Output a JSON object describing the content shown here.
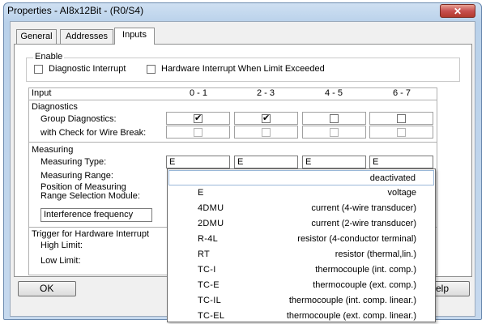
{
  "window": {
    "title": "Properties - AI8x12Bit - (R0/S4)",
    "close_glyph": "✕"
  },
  "tabs": [
    {
      "label": "General"
    },
    {
      "label": "Addresses"
    },
    {
      "label": "Inputs"
    }
  ],
  "enable": {
    "label": "Enable",
    "diagnostic_interrupt": "Diagnostic Interrupt",
    "hardware_interrupt": "Hardware Interrupt When Limit Exceeded"
  },
  "grid": {
    "header": {
      "input": "Input",
      "cols": [
        "0 - 1",
        "2 - 3",
        "4 - 5",
        "6 - 7"
      ]
    },
    "diagnostics": {
      "label": "Diagnostics",
      "group_diagnostics": "Group Diagnostics:",
      "wire_break": "with Check for Wire Break:",
      "group_checked": [
        "✔",
        "✔",
        "",
        ""
      ]
    },
    "measuring": {
      "label": "Measuring",
      "type_label": "Measuring Type:",
      "types": [
        "E",
        "E",
        "E",
        "E"
      ],
      "range_label": "Measuring Range:",
      "position_label_1": "Position of Measuring",
      "position_label_2": "Range Selection Module:",
      "interference": "Interference frequency"
    },
    "trigger": {
      "label": "Trigger for Hardware Interrupt",
      "high": "High Limit:",
      "low": "Low Limit:"
    }
  },
  "buttons": {
    "ok": "OK",
    "help_partial": "elp"
  },
  "dropdown": {
    "options": [
      {
        "key": "",
        "desc": "deactivated"
      },
      {
        "key": "E",
        "desc": "voltage"
      },
      {
        "key": "4DMU",
        "desc": "current (4-wire transducer)"
      },
      {
        "key": "2DMU",
        "desc": "current (2-wire transducer)"
      },
      {
        "key": "R-4L",
        "desc": "resistor (4-conductor terminal)"
      },
      {
        "key": "RT",
        "desc": "resistor (thermal,lin.)"
      },
      {
        "key": "TC-I",
        "desc": "thermocouple (int. comp.)"
      },
      {
        "key": "TC-E",
        "desc": "thermocouple (ext. comp.)"
      },
      {
        "key": "TC-IL",
        "desc": "thermocouple (int. comp. linear.)"
      },
      {
        "key": "TC-EL",
        "desc": "thermocouple (ext. comp. linear.)"
      }
    ]
  }
}
